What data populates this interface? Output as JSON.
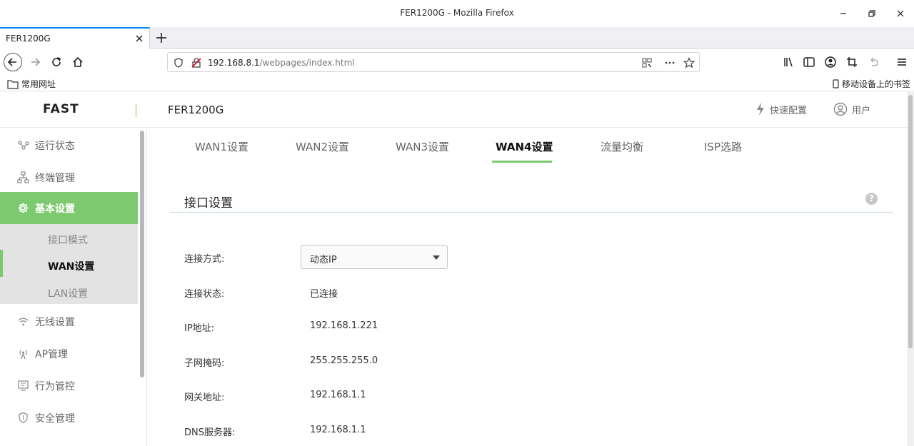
{
  "window": {
    "title": "FER1200G - Mozilla Firefox"
  },
  "browser": {
    "tab_title": "FER1200G",
    "url_host": "192.168.8.1",
    "url_path": "/webpages/index.html",
    "bookmarks_folder": "常用网址",
    "mobile_bookmarks": "移动设备上的书签"
  },
  "header": {
    "logo": "FAST",
    "model": "FER1200G",
    "quick_config": "快速配置",
    "user": "用户"
  },
  "sidebar": {
    "items": [
      {
        "label": "运行状态",
        "icon": "status-icon"
      },
      {
        "label": "终端管理",
        "icon": "terminal-icon"
      },
      {
        "label": "基本设置",
        "icon": "gear-icon"
      },
      {
        "label": "无线设置",
        "icon": "wifi-icon"
      },
      {
        "label": "AP管理",
        "icon": "ap-icon"
      },
      {
        "label": "行为管控",
        "icon": "control-icon"
      },
      {
        "label": "安全管理",
        "icon": "shield-icon"
      }
    ],
    "submenu": [
      {
        "label": "接口模式"
      },
      {
        "label": "WAN设置"
      },
      {
        "label": "LAN设置"
      }
    ]
  },
  "tabs": [
    {
      "label": "WAN1设置"
    },
    {
      "label": "WAN2设置"
    },
    {
      "label": "WAN3设置"
    },
    {
      "label": "WAN4设置"
    },
    {
      "label": "流量均衡"
    },
    {
      "label": "ISP选路"
    }
  ],
  "section": {
    "title": "接口设置"
  },
  "form": {
    "connection_type_label": "连接方式:",
    "connection_type_value": "动态IP",
    "status_label": "连接状态:",
    "status_value": "已连接",
    "ip_label": "IP地址:",
    "ip_value": "192.168.1.221",
    "mask_label": "子网掩码:",
    "mask_value": "255.255.255.0",
    "gateway_label": "网关地址:",
    "gateway_value": "192.168.1.1",
    "dns_label": "DNS服务器:",
    "dns_value": "192.168.1.1"
  },
  "colors": {
    "accent": "#7dc96f",
    "browser_accent": "#0a84ff"
  }
}
